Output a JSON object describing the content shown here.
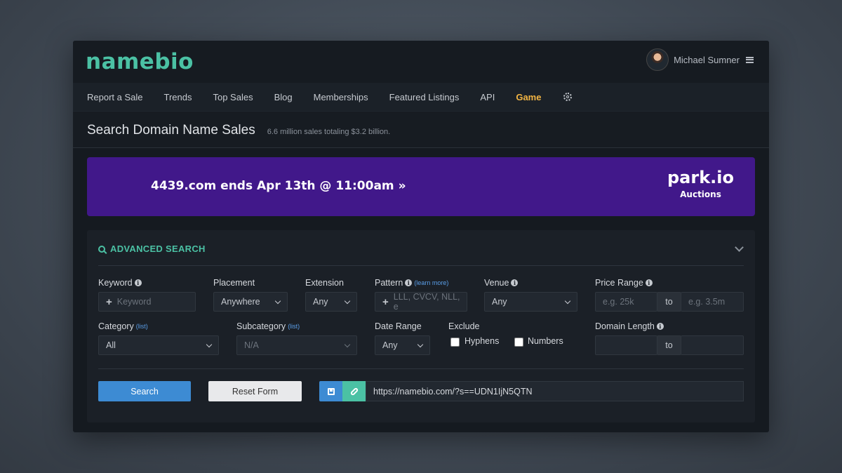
{
  "brand": {
    "logo": "namebio"
  },
  "user": {
    "name": "Michael Sumner"
  },
  "nav": {
    "items": [
      "Report a Sale",
      "Trends",
      "Top Sales",
      "Blog",
      "Memberships",
      "Featured Listings",
      "API",
      "Game"
    ]
  },
  "page": {
    "title": "Search Domain Name Sales",
    "subtitle": "6.6 million sales totaling $3.2 billion."
  },
  "banner": {
    "text": "4439.com ends Apr 13th @ 11:00am »",
    "brand": "park.io",
    "brand_sub": "Auctions",
    "bg_color": "#41188a"
  },
  "search": {
    "heading": "ADVANCED SEARCH",
    "keyword": {
      "label": "Keyword",
      "placeholder": "Keyword"
    },
    "placement": {
      "label": "Placement",
      "value": "Anywhere"
    },
    "extension": {
      "label": "Extension",
      "value": "Any"
    },
    "pattern": {
      "label": "Pattern",
      "link": "(learn more)",
      "placeholder": "LLL, CVCV, NLL, e"
    },
    "venue": {
      "label": "Venue",
      "value": "Any"
    },
    "price_range": {
      "label": "Price Range",
      "min_placeholder": "e.g. 25k",
      "to": "to",
      "max_placeholder": "e.g. 3.5m"
    },
    "category": {
      "label": "Category",
      "link": "(list)",
      "value": "All"
    },
    "subcategory": {
      "label": "Subcategory",
      "link": "(list)",
      "value": "N/A"
    },
    "date_range": {
      "label": "Date Range",
      "value": "Any"
    },
    "exclude": {
      "label": "Exclude",
      "hyphens": "Hyphens",
      "numbers": "Numbers"
    },
    "domain_length": {
      "label": "Domain Length",
      "to": "to"
    },
    "buttons": {
      "search": "Search",
      "reset": "Reset Form"
    },
    "share_url": "https://namebio.com/?s==UDN1IjN5QTN",
    "accent_color": "#4bc1a4",
    "button_color": "#3d8bd3"
  }
}
